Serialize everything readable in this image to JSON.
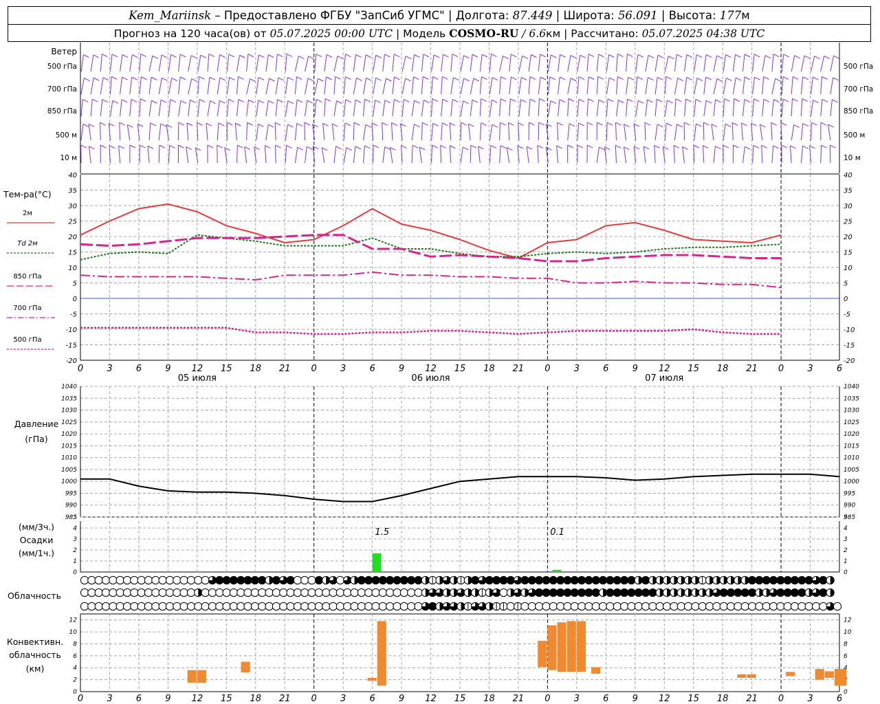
{
  "header": {
    "station": "Kem_Mariinsk",
    "provider_sep": " – ",
    "provider": "Предоставлено ФГБУ \"ЗапСиб УГМС\"",
    "lon_label": "Долгота:",
    "lon_value": "87.449",
    "lat_label": "Широта:",
    "lat_value": "56.091",
    "alt_label": "Высота:",
    "alt_value": "177",
    "alt_unit": "м",
    "sep": " | ",
    "forecast_prefix": "Прогноз на 120 часа(ов) от",
    "forecast_start": "05.07.2025 00:00 UTC",
    "model_label": "Модель",
    "model_name": "COSMO-RU",
    "model_slash": " / ",
    "model_res": "6.6",
    "model_res_unit": "км",
    "computed_label": "Рассчитано:",
    "computed_value": "05.07.2025 04:38 UTC"
  },
  "chart_data": [
    {
      "type": "wind_barbs",
      "title": "Ветер",
      "levels": [
        "500 гПа",
        "700 гПа",
        "850 гПа",
        "500 м",
        "10 м"
      ],
      "color": "#8a2be2"
    },
    {
      "type": "line",
      "title": "Тем-ра(°C)",
      "x_ticks": [
        "0",
        "3",
        "6",
        "9",
        "12",
        "15",
        "18",
        "21",
        "0",
        "3",
        "6",
        "9",
        "12",
        "15",
        "18",
        "21",
        "0",
        "3",
        "6",
        "9",
        "12",
        "15",
        "18",
        "21",
        "0",
        "3",
        "6"
      ],
      "date_labels": [
        "05 июля",
        "06 июля",
        "07 июля"
      ],
      "ylim": [
        -20,
        40
      ],
      "y_ticks": [
        -20,
        -15,
        -10,
        -5,
        0,
        5,
        10,
        15,
        20,
        25,
        30,
        35,
        40
      ],
      "grid": true,
      "legend_position": "left",
      "series": [
        {
          "name": "2м",
          "color": "#e8383a",
          "x": [
            0,
            3,
            6,
            9,
            12,
            15,
            18,
            21,
            24,
            27,
            30,
            33,
            36,
            39,
            42,
            45,
            48,
            51,
            54,
            57,
            60,
            63,
            66,
            69,
            72
          ],
          "y": [
            20.5,
            25,
            29,
            30.5,
            28,
            23.5,
            21,
            18,
            19,
            23.5,
            29,
            24,
            22,
            19,
            15.5,
            13,
            18,
            19,
            23.5,
            24.5,
            22,
            19,
            18.5,
            18,
            20.5
          ]
        },
        {
          "name_prefix": "Td",
          "name": "2м",
          "color": "#1a7a1a",
          "x": [
            0,
            3,
            6,
            9,
            12,
            15,
            18,
            21,
            24,
            27,
            30,
            33,
            36,
            39,
            42,
            45,
            48,
            51,
            54,
            57,
            60,
            63,
            66,
            69,
            72
          ],
          "y": [
            12.5,
            14.5,
            15,
            14.5,
            20.5,
            19.5,
            18.5,
            17,
            17,
            17,
            19.5,
            16,
            16,
            14.5,
            13.5,
            13.5,
            14.5,
            15,
            14.5,
            15,
            16,
            16.5,
            16.5,
            17,
            17.5
          ]
        },
        {
          "name": "850 гПа",
          "color": "#d8228c",
          "x": [
            0,
            3,
            6,
            9,
            12,
            15,
            18,
            21,
            24,
            27,
            30,
            33,
            36,
            39,
            42,
            45,
            48,
            51,
            54,
            57,
            60,
            63,
            66,
            69,
            72
          ],
          "y": [
            17.5,
            17,
            17.5,
            18.5,
            19.5,
            19.5,
            19.5,
            20,
            20.5,
            20.5,
            16,
            16,
            13.5,
            14,
            13.5,
            13,
            12,
            12,
            13,
            13.5,
            14,
            14,
            13.5,
            13,
            13
          ]
        },
        {
          "name": "700 гПа",
          "color": "#d8228c",
          "x": [
            0,
            3,
            6,
            9,
            12,
            15,
            18,
            21,
            24,
            27,
            30,
            33,
            36,
            39,
            42,
            45,
            48,
            51,
            54,
            57,
            60,
            63,
            66,
            69,
            72
          ],
          "y": [
            7.5,
            7,
            7,
            7,
            7,
            6.5,
            6,
            7.5,
            7.5,
            7.5,
            8.5,
            7.5,
            7.5,
            7,
            7,
            6.5,
            6.5,
            5,
            5,
            5.5,
            5,
            5,
            4.5,
            4.5,
            3.5
          ]
        },
        {
          "name": "500 гПа",
          "color": "#d8228c",
          "x": [
            0,
            3,
            6,
            9,
            12,
            15,
            18,
            21,
            24,
            27,
            30,
            33,
            36,
            39,
            42,
            45,
            48,
            51,
            54,
            57,
            60,
            63,
            66,
            69,
            72
          ],
          "y": [
            -9.5,
            -9.5,
            -9.5,
            -9.5,
            -9.5,
            -9.5,
            -11,
            -11,
            -11.5,
            -11.5,
            -11,
            -11,
            -10.5,
            -10.5,
            -11,
            -11.5,
            -11,
            -10.5,
            -10.5,
            -10.5,
            -10.5,
            -10,
            -11,
            -11.5,
            -11.5
          ]
        }
      ]
    },
    {
      "type": "line",
      "title": "Давление",
      "unit": "(гПа)",
      "ylim": [
        985,
        1040
      ],
      "y_ticks": [
        985,
        990,
        995,
        1000,
        1005,
        1010,
        1015,
        1020,
        1025,
        1030,
        1035,
        1040
      ],
      "grid": true,
      "series": [
        {
          "color": "#000000",
          "x": [
            0,
            3,
            6,
            9,
            12,
            15,
            18,
            21,
            24,
            27,
            30,
            33,
            36,
            39,
            42,
            45,
            48,
            51,
            54,
            57,
            60,
            63,
            66,
            69,
            72,
            75,
            78
          ],
          "y": [
            1001,
            1001,
            998,
            996,
            995.5,
            995.5,
            995,
            994,
            992.5,
            991.5,
            991.5,
            994,
            997,
            1000,
            1001,
            1002,
            1002,
            1002,
            1001.5,
            1000.5,
            1001,
            1002,
            1002.5,
            1003,
            1003,
            1003,
            1002
          ]
        }
      ]
    },
    {
      "type": "bar",
      "title": "Осадки",
      "unit_3h": "(мм/3ч.)",
      "unit_1h": "(мм/1ч.)",
      "ylim": [
        0,
        5
      ],
      "y_ticks": [
        0,
        1,
        2,
        3,
        4,
        5
      ],
      "bar_color": "#22dd22",
      "bars": [
        {
          "x": 30,
          "value": 1.7
        },
        {
          "x": 48.5,
          "value": 0.2
        }
      ],
      "annotations": [
        {
          "x": 31,
          "text": "1.5"
        },
        {
          "x": 49,
          "text": "0.1"
        }
      ]
    },
    {
      "type": "table",
      "title": "Облачность",
      "rows": [
        [
          0,
          0,
          0,
          0,
          0,
          0,
          0,
          0,
          0,
          0,
          0,
          0,
          0,
          0,
          0,
          0,
          0,
          0,
          3,
          4,
          4,
          4,
          4,
          4,
          4,
          4,
          2,
          4,
          3,
          4,
          0,
          0,
          0,
          4,
          2,
          3,
          0,
          3,
          2,
          4,
          4,
          4,
          4,
          4,
          4,
          4,
          4,
          4,
          2,
          1,
          2,
          3,
          2,
          1,
          2,
          4,
          3,
          4,
          4,
          4,
          4,
          3,
          4,
          4,
          4,
          4,
          4,
          4,
          4,
          4,
          4,
          4,
          4,
          4,
          4,
          4,
          4,
          4,
          2,
          4,
          2,
          2,
          2,
          2,
          2,
          2,
          2,
          1,
          2,
          2,
          2,
          2,
          2,
          2,
          4,
          4,
          4,
          4,
          4,
          4,
          4,
          4,
          4,
          3,
          4,
          2
        ],
        [
          0,
          0,
          0,
          0,
          0,
          0,
          0,
          0,
          0,
          0,
          0,
          0,
          0,
          0,
          0,
          0,
          2,
          0,
          0,
          0,
          0,
          0,
          0,
          0,
          0,
          0,
          0,
          0,
          0,
          0,
          0,
          0,
          0,
          0,
          0,
          0,
          0,
          0,
          0,
          0,
          0,
          0,
          0,
          0,
          0,
          0,
          0,
          0,
          2,
          3,
          3,
          2,
          2,
          3,
          2,
          2,
          1,
          2,
          3,
          0,
          2,
          3,
          2,
          3,
          4,
          4,
          4,
          4,
          4,
          4,
          4,
          4,
          4,
          2,
          4,
          4,
          4,
          4,
          4,
          4,
          4,
          2,
          2,
          2,
          2,
          2,
          2,
          2,
          2,
          3,
          4,
          4,
          4,
          4,
          4,
          2,
          2,
          3,
          4,
          4,
          4,
          4,
          2,
          3,
          4,
          2
        ],
        [
          0,
          0,
          0,
          0,
          0,
          0,
          0,
          0,
          0,
          0,
          0,
          0,
          0,
          0,
          0,
          0,
          0,
          0,
          0,
          0,
          0,
          0,
          0,
          0,
          0,
          0,
          0,
          0,
          0,
          0,
          0,
          0,
          0,
          0,
          0,
          0,
          0,
          0,
          0,
          0,
          0,
          0,
          0,
          0,
          0,
          0,
          0,
          0,
          3,
          4,
          2,
          3,
          3,
          2,
          1,
          3,
          3,
          2,
          1,
          1,
          0,
          1,
          0,
          0,
          0,
          0,
          0,
          0,
          0,
          0,
          0,
          0,
          0,
          0,
          0,
          0,
          0,
          0,
          0,
          0,
          0,
          0,
          0,
          0,
          0,
          0,
          0,
          0,
          0,
          0,
          0,
          0,
          0,
          0,
          0,
          0,
          0,
          0,
          0,
          0,
          0,
          0,
          0,
          0,
          0,
          3,
          0,
          4
        ]
      ]
    },
    {
      "type": "range_bar",
      "title": "Конвективн. облачность (км)",
      "ylim": [
        0,
        13
      ],
      "y_ticks": [
        0,
        2,
        4,
        6,
        8,
        10,
        12
      ],
      "bar_color": "#f08a30",
      "bars": [
        {
          "x0": 11,
          "x1": 12,
          "bottom": 1.5,
          "top": 3.6
        },
        {
          "x0": 12,
          "x1": 13,
          "bottom": 1.5,
          "top": 3.6
        },
        {
          "x0": 16.5,
          "x1": 17.5,
          "bottom": 3.2,
          "top": 5.0
        },
        {
          "x0": 29.5,
          "x1": 30.5,
          "bottom": 1.8,
          "top": 2.3
        },
        {
          "x0": 30.5,
          "x1": 31.5,
          "bottom": 1.0,
          "top": 11.8
        },
        {
          "x0": 47,
          "x1": 48,
          "bottom": 4.1,
          "top": 8.5
        },
        {
          "x0": 48,
          "x1": 49,
          "bottom": 3.6,
          "top": 11.1
        },
        {
          "x0": 49,
          "x1": 50,
          "bottom": 3.3,
          "top": 11.6
        },
        {
          "x0": 50,
          "x1": 51,
          "bottom": 3.3,
          "top": 11.8
        },
        {
          "x0": 51,
          "x1": 52,
          "bottom": 3.3,
          "top": 11.8
        },
        {
          "x0": 52.5,
          "x1": 53.5,
          "bottom": 3.0,
          "top": 4.1
        },
        {
          "x0": 67.5,
          "x1": 68.5,
          "bottom": 2.3,
          "top": 2.9
        },
        {
          "x0": 68.5,
          "x1": 69.5,
          "bottom": 2.3,
          "top": 2.9
        },
        {
          "x0": 72.5,
          "x1": 73.5,
          "bottom": 2.6,
          "top": 3.3
        },
        {
          "x0": 75.5,
          "x1": 76.5,
          "bottom": 2.0,
          "top": 3.8
        },
        {
          "x0": 76.5,
          "x1": 77.5,
          "bottom": 2.3,
          "top": 3.4
        },
        {
          "x0": 77.5,
          "x1": 78.8,
          "bottom": 1.0,
          "top": 3.8
        }
      ]
    }
  ]
}
